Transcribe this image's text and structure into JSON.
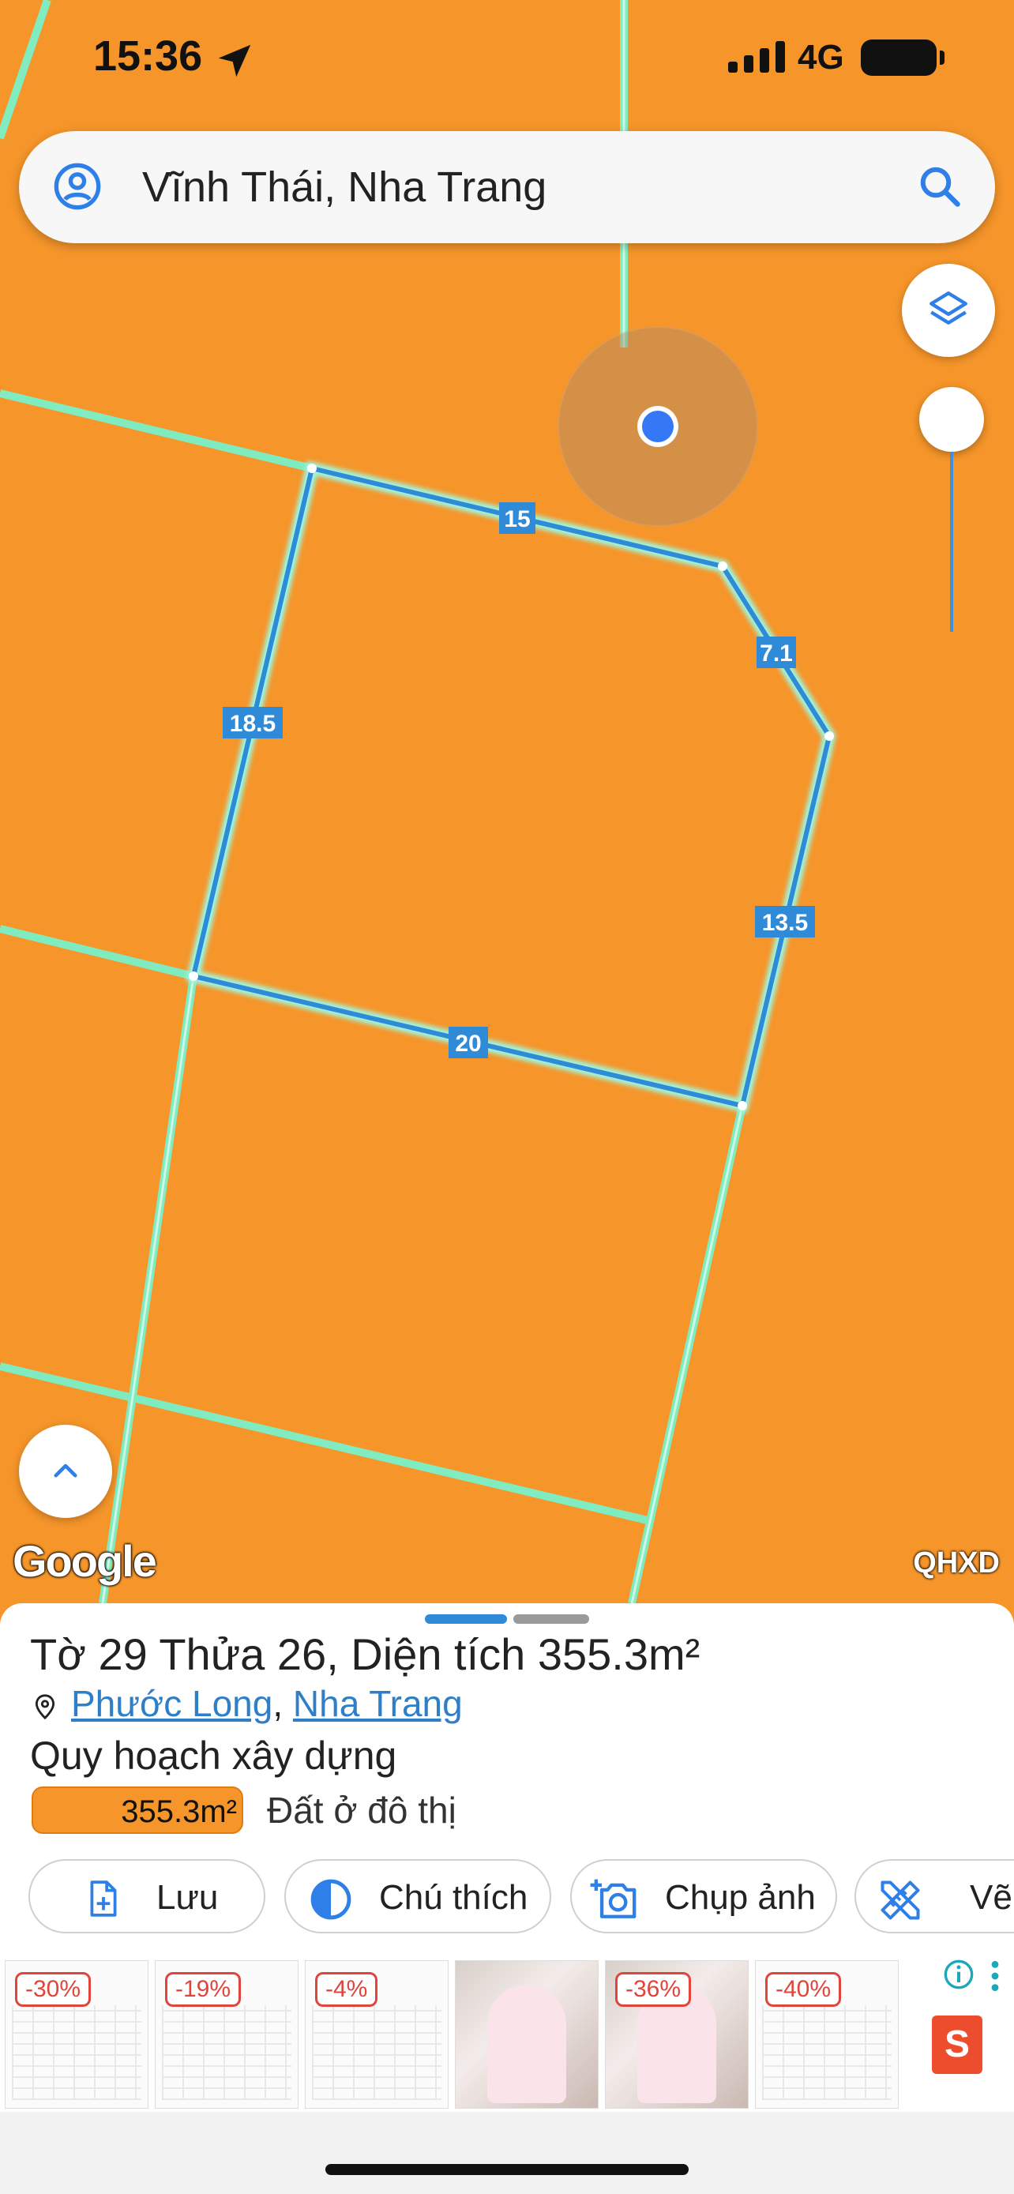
{
  "status_bar": {
    "time": "15:36",
    "network": "4G"
  },
  "search": {
    "query": "Vĩnh Thái, Nha Trang"
  },
  "map": {
    "edge_labels": [
      "15",
      "7.1",
      "18.5",
      "13.5",
      "20"
    ],
    "attribution": "Google",
    "layer_label": "QHXD",
    "colors": {
      "land": "#f5952a",
      "boundary": "#2f8ad8",
      "road": "#7af0c8"
    }
  },
  "parcel": {
    "title_prefix": "Tờ",
    "sheet_no": "29",
    "plot_prefix": "Thửa",
    "plot_no": "26",
    "area_prefix": ", Diện tích",
    "area": "355.3m²",
    "ward": "Phước Long",
    "separator": ",",
    "city": "Nha Trang"
  },
  "planning": {
    "heading": "Quy hoạch xây dựng",
    "legend_value": "355.3m²",
    "land_use": "Đất ở đô thị"
  },
  "actions": [
    {
      "label": "Lưu",
      "icon": "file-add-icon"
    },
    {
      "label": "Chú thích",
      "icon": "contrast-icon"
    },
    {
      "label": "Chụp ảnh",
      "icon": "camera-add-icon"
    },
    {
      "label": "Vẽ",
      "icon": "ruler-pencil-icon"
    }
  ],
  "ads": [
    {
      "badge": "-30%"
    },
    {
      "badge": "-19%"
    },
    {
      "badge": "-4%"
    },
    {
      "badge": ""
    },
    {
      "badge": "-36%"
    },
    {
      "badge": "-40%"
    }
  ],
  "ad_brand": {
    "shop_glyph": "S"
  }
}
